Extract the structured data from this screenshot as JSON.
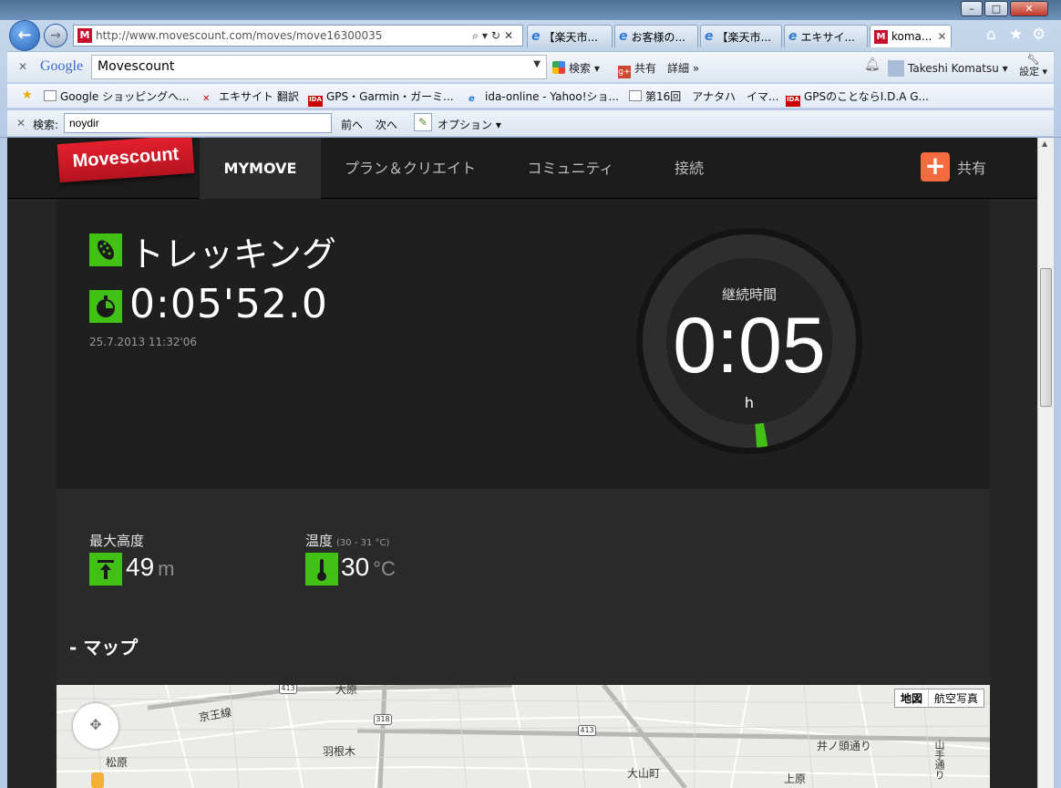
{
  "browser": {
    "url": "http://www.movescount.com/moves/move16300035",
    "tabs": [
      {
        "label": "【楽天市...",
        "icon": "ie-icon"
      },
      {
        "label": "お客様の...",
        "icon": "ie-icon"
      },
      {
        "label": "【楽天市...",
        "icon": "ie-icon"
      },
      {
        "label": "エキサイ...",
        "icon": "ie-icon"
      },
      {
        "label": "koma...",
        "icon": "movescount-icon",
        "active": true
      }
    ],
    "google_bar": {
      "logo": "Google",
      "query": "Movescount",
      "search_label": "検索",
      "share_label": "共有",
      "more_label": "詳細 »",
      "user": "Takeshi Komatsu",
      "settings_label": "設定"
    },
    "favorites": [
      "Google ショッピングへ...",
      "エキサイト 翻訳",
      "GPS・Garmin・ガーミ...",
      "ida-online - Yahoo!ショ...",
      "第16回　アナタハ　イマ...",
      "GPSのことならI.D.A G..."
    ],
    "find_bar": {
      "label": "検索:",
      "value": "noydir",
      "prev_label": "前へ",
      "next_label": "次へ",
      "options_label": "オプション"
    }
  },
  "site": {
    "logo": "Movescount",
    "nav": [
      {
        "label": "MYMOVE",
        "active": true
      },
      {
        "label": "プラン＆クリエイト"
      },
      {
        "label": "コミュニティ"
      },
      {
        "label": "接続"
      }
    ],
    "share_label": "共有"
  },
  "move": {
    "activity": "トレッキング",
    "duration": "0:05'52.0",
    "datetime": "25.7.2013 11:32'06",
    "gauge": {
      "label": "継続時間",
      "value": "0:05",
      "unit": "h",
      "fill_fraction": 0.1
    }
  },
  "stats": {
    "max_altitude": {
      "label": "最大高度",
      "value": "49",
      "unit": "m"
    },
    "temperature": {
      "label": "温度",
      "range": "(30 - 31 °C)",
      "value": "30",
      "unit": "°C"
    }
  },
  "map": {
    "heading": "- マップ",
    "type_map": "地図",
    "type_satellite": "航空写真",
    "labels": [
      "大原",
      "京王線",
      "松原",
      "羽根木",
      "大山町",
      "井ノ頭通り",
      "山手通り",
      "上原"
    ],
    "routes": [
      "413",
      "318",
      "413"
    ]
  },
  "colors": {
    "accent_green": "#43c016",
    "brand_red": "#e4202e",
    "share_orange": "#f36b3f"
  }
}
